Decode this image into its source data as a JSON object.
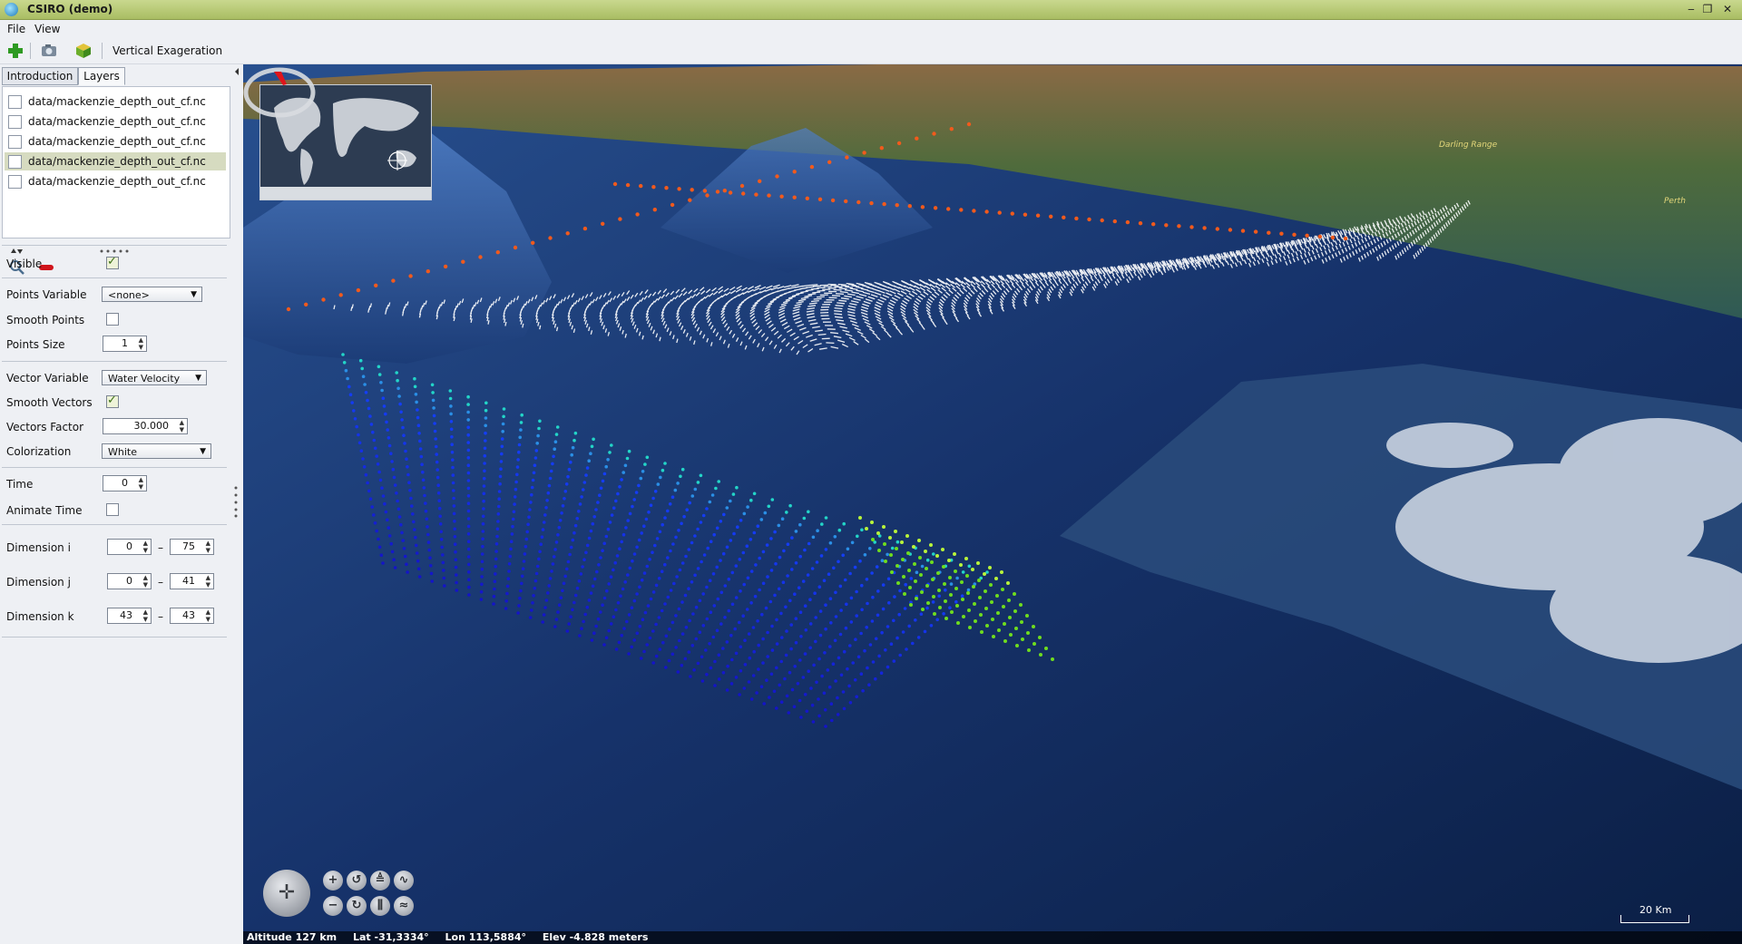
{
  "window": {
    "title": "CSIRO (demo)",
    "minimize": "‒",
    "restore": "❐",
    "close": "✕"
  },
  "menu": {
    "file": "File",
    "view": "View"
  },
  "toolbar": {
    "vertical_exaggeration": "Vertical Exageration"
  },
  "tabs": {
    "introduction": "Introduction",
    "layers": "Layers"
  },
  "layers": [
    {
      "label": "data/mackenzie_depth_out_cf.nc",
      "selected": false
    },
    {
      "label": "data/mackenzie_depth_out_cf.nc",
      "selected": false
    },
    {
      "label": "data/mackenzie_depth_out_cf.nc",
      "selected": false
    },
    {
      "label": "data/mackenzie_depth_out_cf.nc",
      "selected": true
    },
    {
      "label": "data/mackenzie_depth_out_cf.nc",
      "selected": false
    }
  ],
  "props": {
    "visible_label": "Visible",
    "visible": true,
    "points_variable_label": "Points Variable",
    "points_variable": "<none>",
    "smooth_points_label": "Smooth Points",
    "smooth_points": false,
    "points_size_label": "Points Size",
    "points_size": "1",
    "vector_variable_label": "Vector Variable",
    "vector_variable": "Water Velocity",
    "smooth_vectors_label": "Smooth Vectors",
    "smooth_vectors": true,
    "vectors_factor_label": "Vectors Factor",
    "vectors_factor": "30.000",
    "colorization_label": "Colorization",
    "colorization": "White",
    "time_label": "Time",
    "time": "0",
    "animate_time_label": "Animate Time",
    "animate_time": false,
    "dim_i_label": "Dimension i",
    "dim_i_min": "0",
    "dim_i_max": "75",
    "dim_j_label": "Dimension j",
    "dim_j_min": "0",
    "dim_j_max": "41",
    "dim_k_label": "Dimension k",
    "dim_k_min": "43",
    "dim_k_max": "43",
    "range_separator": "–"
  },
  "globe": {
    "labels": {
      "darling_range": "Darling Range",
      "perth": "Perth"
    },
    "scale": "20 Km",
    "status": {
      "altitude": "Altitude 127 km",
      "lat": "Lat -31,3334°",
      "lon": "Lon 113,5884°",
      "elev": "Elev -4.828 meters"
    }
  },
  "colors": {
    "title_bar": "#b7c878",
    "panel_bg": "#eef0f4",
    "ocean": "#1d3f7a",
    "land": "#4d6b3a",
    "vector": "#ffffff",
    "point_deep": "#1020d0",
    "point_green": "#7be01f"
  }
}
